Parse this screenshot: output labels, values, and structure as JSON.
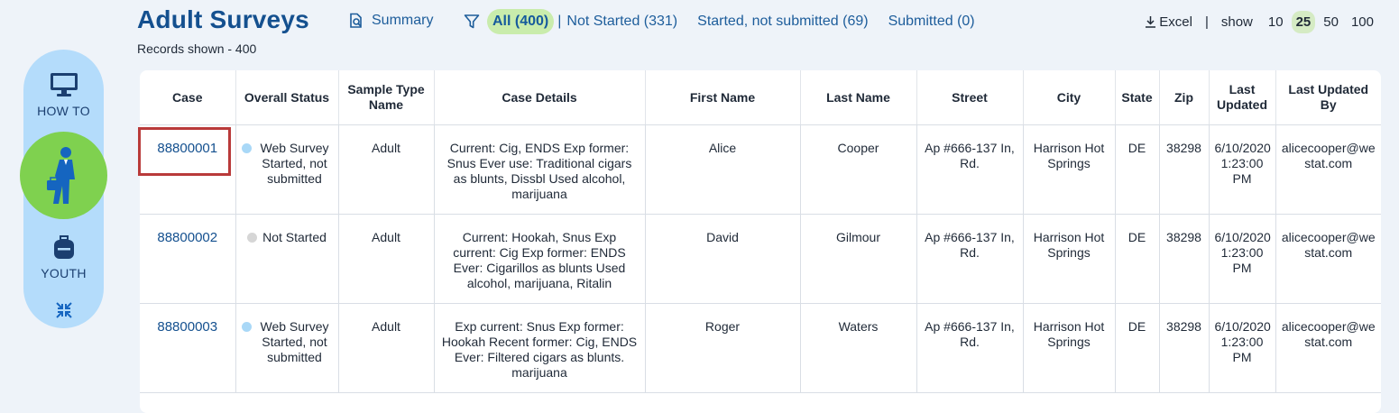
{
  "header": {
    "title": "Adult Surveys",
    "records_label": "Records shown - 400",
    "summary_label": "Summary"
  },
  "filters": {
    "all": "All (400)",
    "separator": "|",
    "not_started": "Not Started (331)",
    "started": "Started, not submitted (69)",
    "submitted": "Submitted (0)"
  },
  "toolbar": {
    "excel_label": "Excel",
    "pipe": "|",
    "show_label": "show",
    "page_sizes": [
      "10",
      "25",
      "50",
      "100"
    ],
    "selected_page_size": "25"
  },
  "sidebar": {
    "how_to_label": "HOW TO",
    "youth_label": "YOUTH"
  },
  "colors": {
    "accent": "#14508f",
    "active_filter_bg": "#c9ecac",
    "sidebar_bg": "#b4dcfb",
    "sidebar_active": "#7fd14f",
    "highlight": "#b93a3a"
  },
  "table": {
    "columns": {
      "case": "Case",
      "overall_status": "Overall Status",
      "sample_type": "Sample Type Name",
      "case_details": "Case Details",
      "first_name": "First Name",
      "last_name": "Last Name",
      "street": "Street",
      "city": "City",
      "state": "State",
      "zip": "Zip",
      "last_updated": "Last Updated",
      "last_updated_by": "Last Updated By"
    },
    "rows": [
      {
        "case": "88800001",
        "status": "Web Survey Started, not submitted",
        "sample_type": "Adult",
        "details": "Current: Cig, ENDS Exp former: Snus Ever use: Traditional cigars as blunts, Dissbl Used alcohol, marijuana",
        "first_name": "Alice",
        "last_name": "Cooper",
        "street": "Ap #666-137 In, Rd.",
        "city": "Harrison Hot Springs",
        "state": "DE",
        "zip": "38298",
        "last_updated": "6/10/2020 1:23:00 PM",
        "last_updated_by": "alicecooper@westat.com"
      },
      {
        "case": "88800002",
        "status": "Not Started",
        "sample_type": "Adult",
        "details": "Current: Hookah, Snus Exp current: Cig Exp former: ENDS Ever: Cigarillos as blunts Used alcohol, marijuana, Ritalin",
        "first_name": "David",
        "last_name": "Gilmour",
        "street": "Ap #666-137 In, Rd.",
        "city": "Harrison Hot Springs",
        "state": "DE",
        "zip": "38298",
        "last_updated": "6/10/2020 1:23:00 PM",
        "last_updated_by": "alicecooper@westat.com"
      },
      {
        "case": "88800003",
        "status": "Web Survey Started, not submitted",
        "sample_type": "Adult",
        "details": "Exp current: Snus Exp former: Hookah Recent former: Cig, ENDS Ever: Filtered cigars as blunts. marijuana",
        "first_name": "Roger",
        "last_name": "Waters",
        "street": "Ap #666-137 In, Rd.",
        "city": "Harrison Hot Springs",
        "state": "DE",
        "zip": "38298",
        "last_updated": "6/10/2020 1:23:00 PM",
        "last_updated_by": "alicecooper@westat.com"
      }
    ]
  }
}
